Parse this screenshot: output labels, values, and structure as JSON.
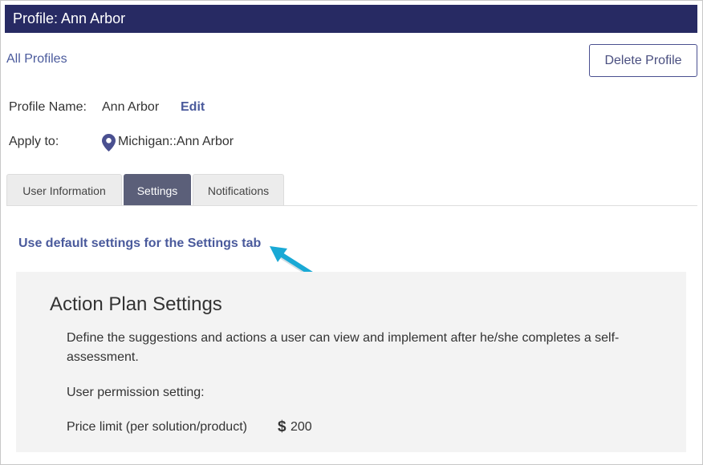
{
  "header": {
    "title": "Profile: Ann Arbor"
  },
  "nav": {
    "all_profiles": "All Profiles"
  },
  "actions": {
    "delete_profile": "Delete Profile"
  },
  "profile": {
    "name_label": "Profile Name:",
    "name_value": "Ann Arbor",
    "edit_label": "Edit",
    "apply_label": "Apply to:",
    "apply_value": "Michigan::Ann Arbor",
    "apply_icon": "location-pin-icon"
  },
  "tabs": [
    {
      "label": "User Information",
      "active": false
    },
    {
      "label": "Settings",
      "active": true
    },
    {
      "label": "Notifications",
      "active": false
    }
  ],
  "settings": {
    "default_link": "Use default settings for the Settings tab",
    "pointer_icon": "arrow-pointer-icon"
  },
  "action_plan": {
    "title": "Action Plan Settings",
    "description": "Define the suggestions and actions a user can view and implement after he/she completes a self-assessment.",
    "permission_label": "User permission setting:",
    "price_label": "Price limit (per solution/product)",
    "currency_icon": "dollar-icon",
    "price_value": "200"
  },
  "colors": {
    "header_bg": "#272a63",
    "link": "#4a5a9c",
    "active_tab": "#5b5f79",
    "arrow": "#19a9d5",
    "panel_bg": "#f3f3f3"
  }
}
